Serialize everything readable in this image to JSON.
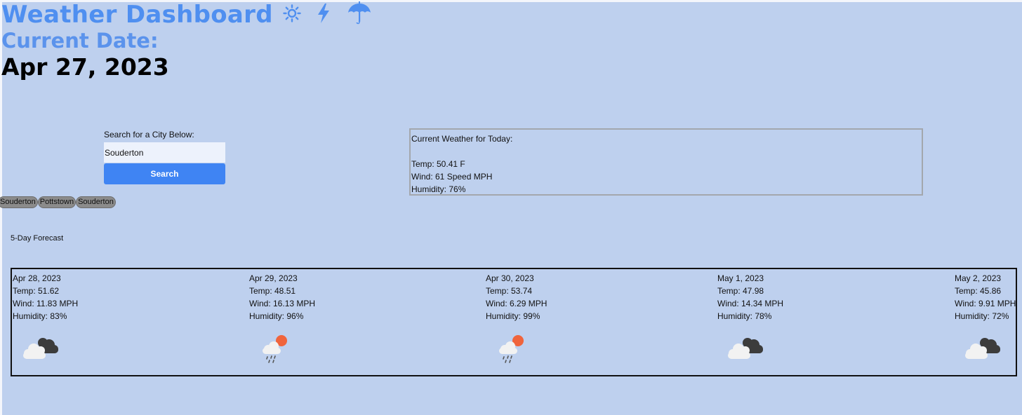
{
  "header": {
    "title": "Weather Dashboard",
    "icons": [
      "sun-icon",
      "lightning-icon",
      "umbrella-icon"
    ],
    "current_date_label": "Current Date:",
    "current_date": "Apr 27, 2023"
  },
  "search": {
    "label": "Search for a City Below:",
    "value": "Souderton",
    "placeholder": "",
    "button_label": "Search"
  },
  "history": [
    "Souderton",
    "Pottstown",
    "Souderton"
  ],
  "current": {
    "heading": "Current Weather for Today:",
    "temp": "Temp: 50.41 F",
    "wind": "Wind: 61 Speed MPH",
    "humidity": "Humidity: 76%"
  },
  "forecast": {
    "label": "5-Day Forecast",
    "days": [
      {
        "date": "Apr 28, 2023",
        "temp": "Temp: 51.62",
        "wind": "Wind: 11.83 MPH",
        "humidity": "Humidity: 83%",
        "icon": "broken-clouds-icon"
      },
      {
        "date": "Apr 29, 2023",
        "temp": "Temp: 48.51",
        "wind": "Wind: 16.13 MPH",
        "humidity": "Humidity: 96%",
        "icon": "rain-icon"
      },
      {
        "date": "Apr 30, 2023",
        "temp": "Temp: 53.74",
        "wind": "Wind: 6.29 MPH",
        "humidity": "Humidity: 99%",
        "icon": "rain-icon"
      },
      {
        "date": "May 1, 2023",
        "temp": "Temp: 47.98",
        "wind": "Wind: 14.34 MPH",
        "humidity": "Humidity: 78%",
        "icon": "broken-clouds-icon"
      },
      {
        "date": "May 2, 2023",
        "temp": "Temp: 45.86",
        "wind": "Wind: 9.91 MPH",
        "humidity": "Humidity: 72%",
        "icon": "broken-clouds-icon"
      }
    ]
  },
  "colors": {
    "background": "#bed0ee",
    "accent": "#4f8ff0",
    "button": "#3f84f3"
  }
}
